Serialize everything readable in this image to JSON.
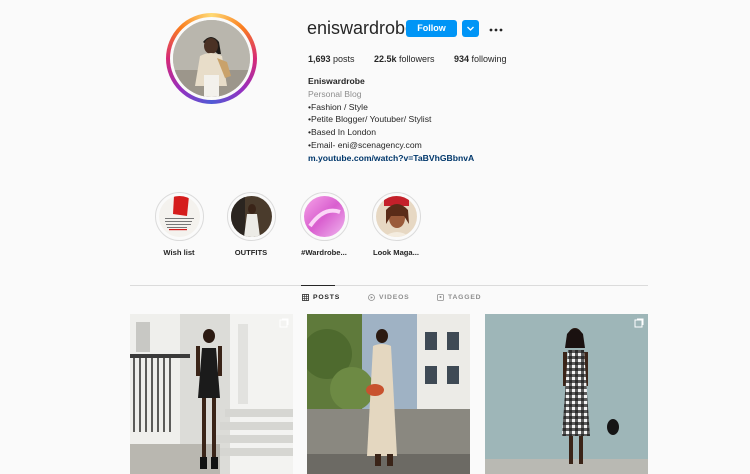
{
  "profile": {
    "username": "eniswardrobe",
    "follow_label": "Follow",
    "stats": {
      "posts_count": "1,693",
      "posts_label": "posts",
      "followers_count": "22.5k",
      "followers_label": "followers",
      "following_count": "934",
      "following_label": "following"
    },
    "bio": {
      "name": "Eniswardrobe",
      "category": "Personal Blog",
      "lines": [
        "•Fashion / Style",
        "•Petite Blogger/ Youtuber/ Stylist",
        "•Based In London",
        "•Email- eni@scenagency.com"
      ],
      "link": "m.youtube.com/watch?v=TaBVhGBbnvA"
    }
  },
  "highlights": [
    {
      "label": "Wish list",
      "icon": "highlight-cover"
    },
    {
      "label": "OUTFITS",
      "icon": "highlight-cover"
    },
    {
      "label": "#Wardrobe...",
      "icon": "highlight-cover"
    },
    {
      "label": "Look Maga...",
      "icon": "highlight-cover"
    }
  ],
  "tabs": [
    {
      "label": "POSTS",
      "icon": "grid-icon",
      "active": true
    },
    {
      "label": "VIDEOS",
      "icon": "play-circle-icon",
      "active": false
    },
    {
      "label": "TAGGED",
      "icon": "tag-icon",
      "active": false
    }
  ],
  "colors": {
    "accent": "#0095f6",
    "link": "#00376b",
    "muted": "#8e8e8e",
    "text": "#262626",
    "background": "#fafafa"
  }
}
